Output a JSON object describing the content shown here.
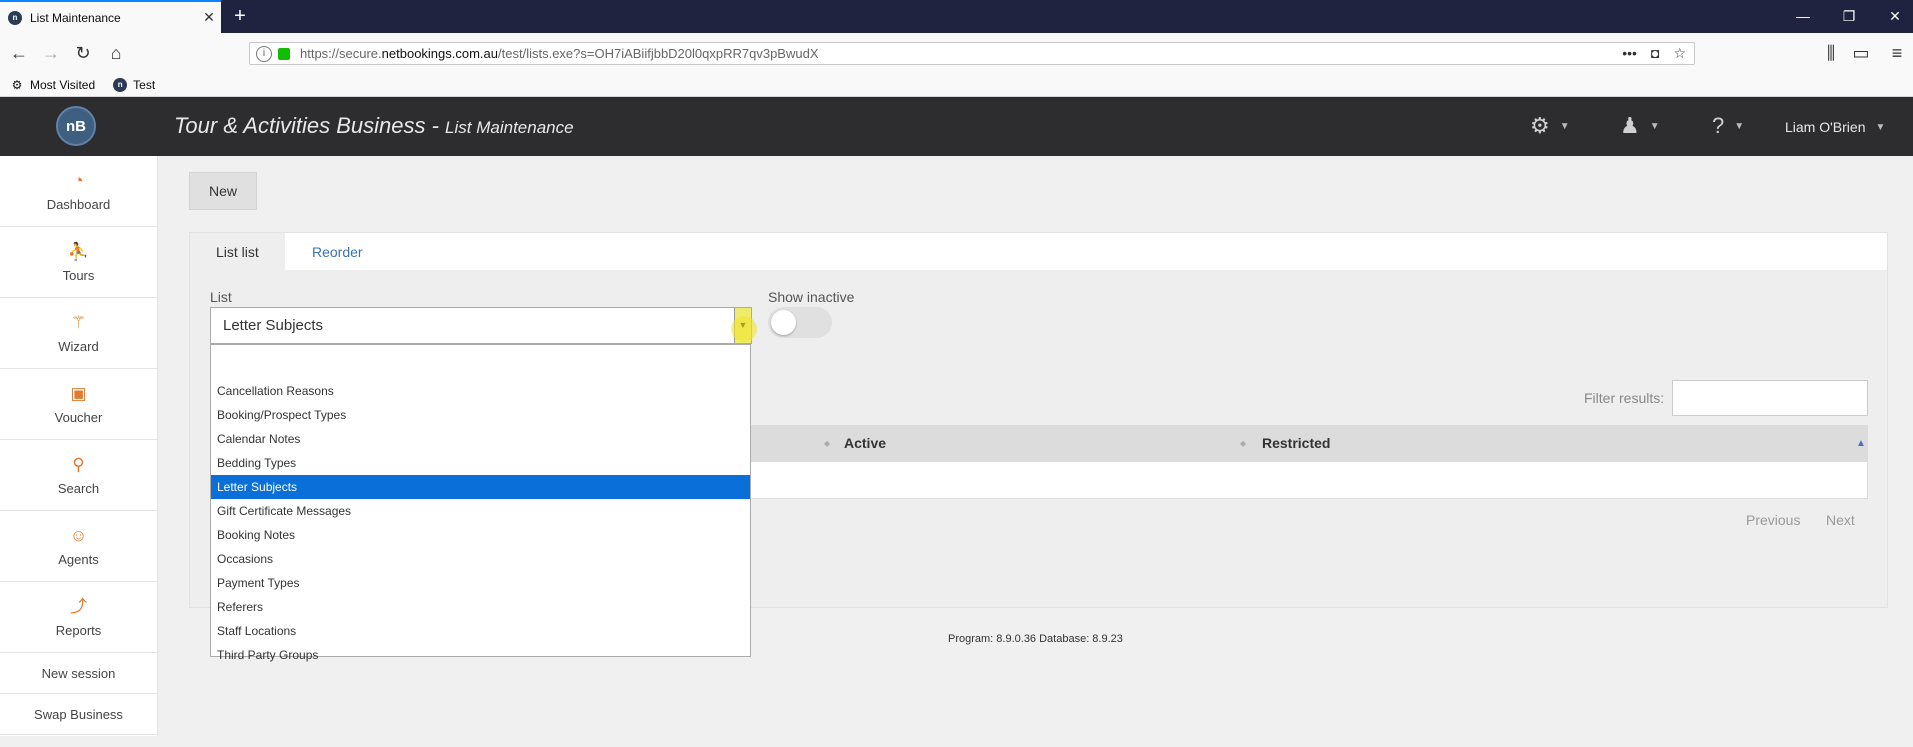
{
  "browser": {
    "tab_title": "List Maintenance",
    "url_prefix": "https://secure.",
    "url_domain": "netbookings.com.au",
    "url_path": "/test/lists.exe?s=OH7iABiifjbbD20l0qxpRR7qv3pBwudX",
    "bookmarks": [
      {
        "label": "Most Visited",
        "icon": "gear-icon"
      },
      {
        "label": "Test",
        "icon": "netbookings-icon"
      }
    ]
  },
  "header": {
    "logo_text": "nB",
    "title": "Tour & Activities Business",
    "separator": " - ",
    "subtitle": "List Maintenance",
    "user_name": "Liam O'Brien"
  },
  "sidebar": {
    "items": [
      {
        "label": "Dashboard",
        "icon": "dashboard-gauge-icon"
      },
      {
        "label": "Tours",
        "icon": "tours-icon"
      },
      {
        "label": "Wizard",
        "icon": "wizard-wand-icon"
      },
      {
        "label": "Voucher",
        "icon": "gift-icon"
      },
      {
        "label": "Search",
        "icon": "search-icon"
      },
      {
        "label": "Agents",
        "icon": "agent-icon"
      },
      {
        "label": "Reports",
        "icon": "chart-icon"
      }
    ],
    "links": [
      "New session",
      "Swap Business"
    ]
  },
  "toolbar": {
    "new_label": "New"
  },
  "panel": {
    "tabs": [
      "List list",
      "Reorder"
    ],
    "list_label": "List",
    "list_value": "Letter Subjects",
    "show_inactive_label": "Show inactive",
    "show_inactive_on": false,
    "filter_label": "Filter results:",
    "columns": [
      "Active",
      "Restricted"
    ],
    "pager": {
      "previous": "Previous",
      "next": "Next"
    }
  },
  "dropdown": {
    "options": [
      "",
      "Cancellation Reasons",
      "Booking/Prospect Types",
      "Calendar Notes",
      "Bedding Types",
      "Letter Subjects",
      "Gift Certificate Messages",
      "Booking Notes",
      "Occasions",
      "Payment Types",
      "Referers",
      "Staff Locations",
      "Third Party Groups"
    ],
    "selected": "Letter Subjects"
  },
  "footer": {
    "version": "Program: 8.9.0.36 Database: 8.9.23"
  },
  "colors": {
    "accent": "#0a6fd8",
    "link": "#3b73ad",
    "header_bg": "#2d2d30",
    "sidebar_icon": "#e07a2f"
  }
}
